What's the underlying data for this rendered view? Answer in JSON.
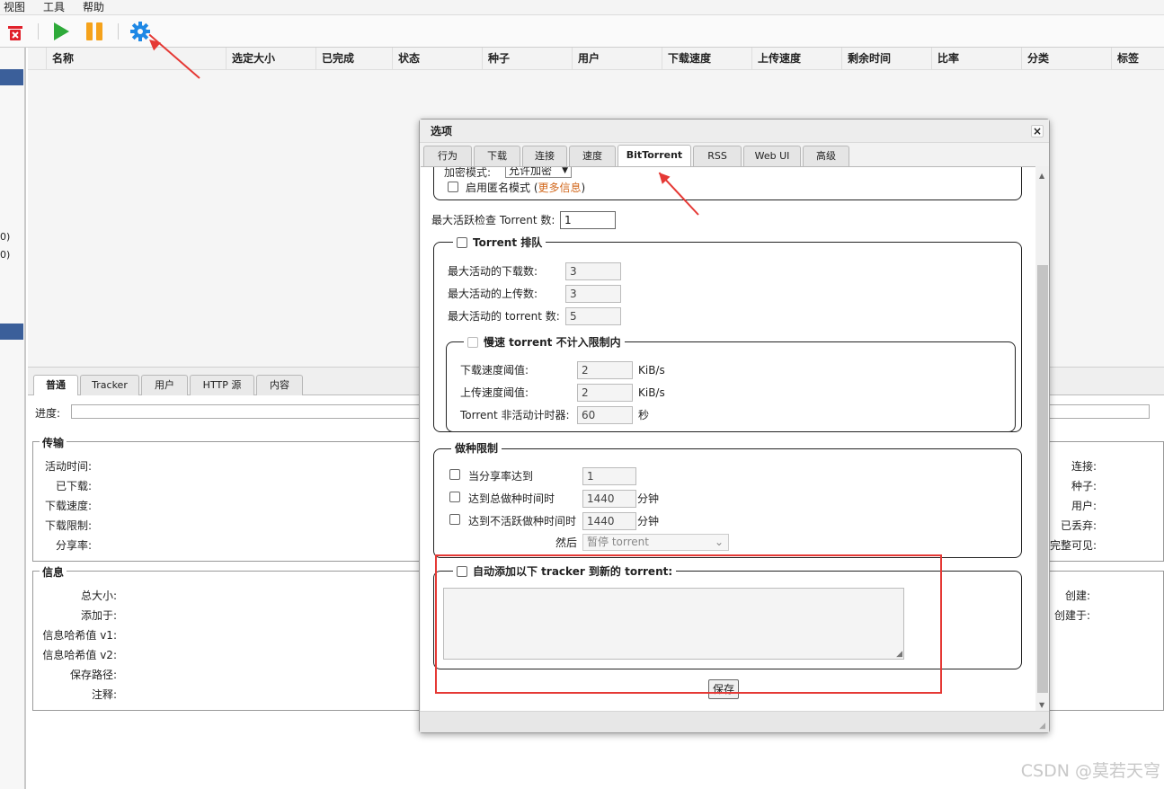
{
  "menu": [
    "视图",
    "工具",
    "帮助"
  ],
  "toolbar": {
    "delete_icon": "trash-icon",
    "start_icon": "play-icon",
    "pause_icon": "pause-icon",
    "options_icon": "gear-icon"
  },
  "sidebar": {
    "counts": [
      "0)",
      "0)"
    ]
  },
  "table": {
    "columns": [
      "名称",
      "选定大小",
      "已完成",
      "状态",
      "种子",
      "用户",
      "下载速度",
      "上传速度",
      "剩余时间",
      "比率",
      "分类",
      "标签"
    ]
  },
  "properties": {
    "tabs": [
      "普通",
      "Tracker",
      "用户",
      "HTTP 源",
      "内容"
    ],
    "progress_label": "进度:",
    "transfer": {
      "legend": "传输",
      "labels": [
        "活动时间:",
        "已下载:",
        "下载速度:",
        "下载限制:",
        "分享率:"
      ],
      "right_labels": [
        "连接:",
        "种子:",
        "用户:",
        "已丢弃:",
        "完整可见:"
      ]
    },
    "info": {
      "legend": "信息",
      "labels": [
        "总大小:",
        "添加于:",
        "信息哈希值 v1:",
        "信息哈希值 v2:",
        "保存路径:",
        "注释:"
      ],
      "right_labels": [
        "创建:",
        "创建于:"
      ]
    }
  },
  "dialog": {
    "title": "选项",
    "close": "×",
    "tabs": [
      "行为",
      "下载",
      "连接",
      "速度",
      "BitTorrent",
      "RSS",
      "Web UI",
      "高级"
    ],
    "active_tab": "BitTorrent",
    "privacy": {
      "encryption_label": "加密模式:",
      "encryption_value": "允许加密",
      "anonymous_label": "启用匿名模式 (",
      "anonymous_link": "更多信息",
      "anonymous_suffix": ")"
    },
    "max_active_checking_label": "最大活跃检查 Torrent 数:",
    "max_active_checking_value": "1",
    "queueing": {
      "legend": "Torrent 排队",
      "max_downloads_label": "最大活动的下载数:",
      "max_downloads_value": "3",
      "max_uploads_label": "最大活动的上传数:",
      "max_uploads_value": "3",
      "max_torrents_label": "最大活动的 torrent 数:",
      "max_torrents_value": "5",
      "slow": {
        "legend": "慢速 torrent 不计入限制内",
        "dl_label": "下载速度阈值:",
        "dl_value": "2",
        "dl_unit": "KiB/s",
        "ul_label": "上传速度阈值:",
        "ul_value": "2",
        "ul_unit": "KiB/s",
        "timer_label": "Torrent 非活动计时器:",
        "timer_value": "60",
        "timer_unit": "秒"
      }
    },
    "seeding": {
      "legend": "做种限制",
      "ratio_label": "当分享率达到",
      "ratio_value": "1",
      "total_time_label": "达到总做种时间时",
      "total_time_value": "1440",
      "total_time_unit": "分钟",
      "inactive_time_label": "达到不活跃做种时间时",
      "inactive_time_value": "1440",
      "inactive_time_unit": "分钟",
      "then_label": "然后",
      "then_value": "暂停 torrent"
    },
    "trackers": {
      "legend": "自动添加以下 tracker 到新的 torrent:"
    },
    "save": "保存"
  },
  "watermark": "CSDN @莫若天穹",
  "colors": {
    "highlight": "#e53935",
    "accent": "#3b5f9a"
  }
}
